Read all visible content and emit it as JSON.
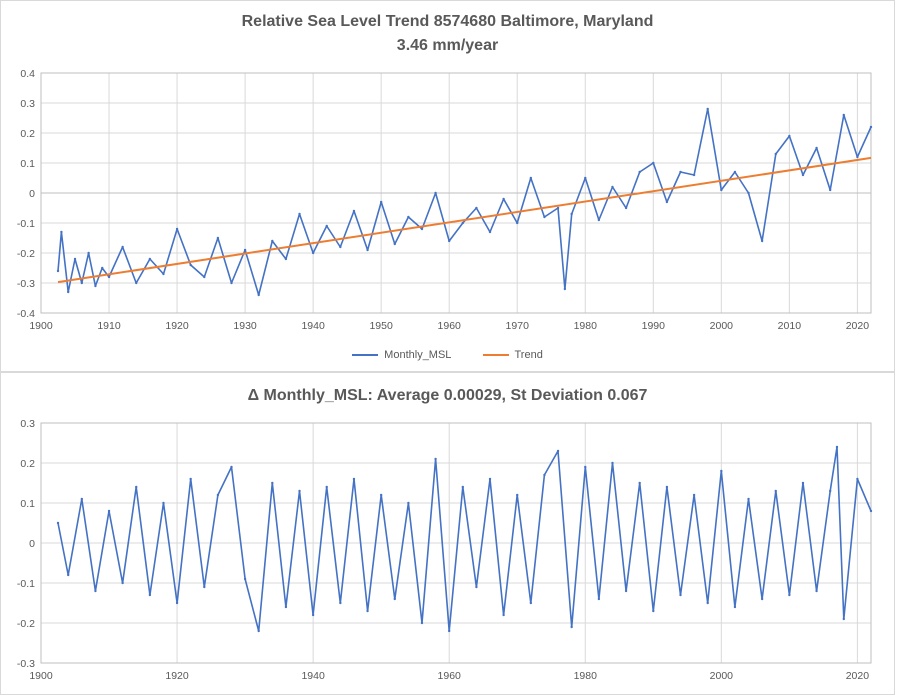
{
  "colors": {
    "msl": "#4472c4",
    "trend": "#ed7d31",
    "grid": "#d9d9d9",
    "axis": "#bfbfbf",
    "text": "#595959"
  },
  "chart_data": [
    {
      "type": "line",
      "title": "Relative Sea Level Trend 8574680 Baltimore, Maryland",
      "subtitle": "3.46 mm/year",
      "xlim": [
        1900,
        2022
      ],
      "ylim": [
        -0.4,
        0.4
      ],
      "x_ticks": [
        "1900",
        "1910",
        "1920",
        "1930",
        "1940",
        "1950",
        "1960",
        "1970",
        "1980",
        "1990",
        "2000",
        "2010",
        "2020"
      ],
      "y_ticks": [
        "0.4",
        "0.3",
        "0.2",
        "0.1",
        "0",
        "-0.1",
        "-0.2",
        "-0.3",
        "-0.4"
      ],
      "grid": true,
      "legend_position": "bottom",
      "series": [
        {
          "name": "Monthly_MSL",
          "x": [
            1902.5,
            1903,
            1904,
            1905,
            1906,
            1907,
            1908,
            1909,
            1910,
            1912,
            1914,
            1916,
            1918,
            1920,
            1922,
            1924,
            1926,
            1928,
            1930,
            1932,
            1934,
            1936,
            1938,
            1940,
            1942,
            1944,
            1946,
            1948,
            1950,
            1952,
            1954,
            1956,
            1958,
            1960,
            1962,
            1964,
            1966,
            1968,
            1970,
            1972,
            1974,
            1976,
            1977,
            1978,
            1980,
            1982,
            1984,
            1986,
            1988,
            1990,
            1992,
            1994,
            1996,
            1998,
            2000,
            2002,
            2004,
            2006,
            2008,
            2010,
            2012,
            2014,
            2016,
            2018,
            2020,
            2022
          ],
          "values": [
            -0.26,
            -0.13,
            -0.33,
            -0.22,
            -0.3,
            -0.2,
            -0.31,
            -0.25,
            -0.28,
            -0.18,
            -0.3,
            -0.22,
            -0.27,
            -0.12,
            -0.24,
            -0.28,
            -0.15,
            -0.3,
            -0.19,
            -0.34,
            -0.16,
            -0.22,
            -0.07,
            -0.2,
            -0.11,
            -0.18,
            -0.06,
            -0.19,
            -0.03,
            -0.17,
            -0.08,
            -0.12,
            0.0,
            -0.16,
            -0.1,
            -0.05,
            -0.13,
            -0.02,
            -0.1,
            0.05,
            -0.08,
            -0.05,
            -0.32,
            -0.07,
            0.05,
            -0.09,
            0.02,
            -0.05,
            0.07,
            0.1,
            -0.03,
            0.07,
            0.06,
            0.28,
            0.01,
            0.07,
            0.0,
            -0.16,
            0.13,
            0.19,
            0.06,
            0.15,
            0.01,
            0.26,
            0.12,
            0.22
          ]
        },
        {
          "name": "Trend",
          "x": [
            1902.5,
            2022
          ],
          "values": [
            -0.297,
            0.117
          ]
        }
      ]
    },
    {
      "type": "line",
      "title": "Δ Monthly_MSL: Average 0.00029, St Deviation 0.067",
      "xlim": [
        1900,
        2022
      ],
      "ylim": [
        -0.3,
        0.3
      ],
      "x_ticks": [
        "1900",
        "1920",
        "1940",
        "1960",
        "1980",
        "2000",
        "2020"
      ],
      "y_ticks": [
        "0.3",
        "0.2",
        "0.1",
        "0",
        "-0.1",
        "-0.2",
        "-0.3"
      ],
      "grid": true,
      "series": [
        {
          "x": [
            1902.5,
            1904,
            1906,
            1908,
            1910,
            1912,
            1914,
            1916,
            1918,
            1920,
            1922,
            1924,
            1926,
            1928,
            1930,
            1932,
            1934,
            1936,
            1938,
            1940,
            1942,
            1944,
            1946,
            1948,
            1950,
            1952,
            1954,
            1956,
            1958,
            1960,
            1962,
            1964,
            1966,
            1968,
            1970,
            1972,
            1974,
            1976,
            1978,
            1980,
            1982,
            1984,
            1986,
            1988,
            1990,
            1992,
            1994,
            1996,
            1998,
            2000,
            2002,
            2004,
            2006,
            2008,
            2010,
            2012,
            2014,
            2016,
            2017,
            2018,
            2020,
            2022
          ],
          "values": [
            0.05,
            -0.08,
            0.11,
            -0.12,
            0.08,
            -0.1,
            0.14,
            -0.13,
            0.1,
            -0.15,
            0.16,
            -0.11,
            0.12,
            0.19,
            -0.09,
            -0.22,
            0.15,
            -0.16,
            0.13,
            -0.18,
            0.14,
            -0.15,
            0.16,
            -0.17,
            0.12,
            -0.14,
            0.1,
            -0.2,
            0.21,
            -0.22,
            0.14,
            -0.11,
            0.16,
            -0.18,
            0.12,
            -0.15,
            0.17,
            0.23,
            -0.21,
            0.19,
            -0.14,
            0.2,
            -0.12,
            0.15,
            -0.17,
            0.14,
            -0.13,
            0.12,
            -0.15,
            0.18,
            -0.16,
            0.11,
            -0.14,
            0.13,
            -0.13,
            0.15,
            -0.12,
            0.13,
            0.24,
            -0.19,
            0.16,
            0.08
          ]
        }
      ]
    }
  ]
}
